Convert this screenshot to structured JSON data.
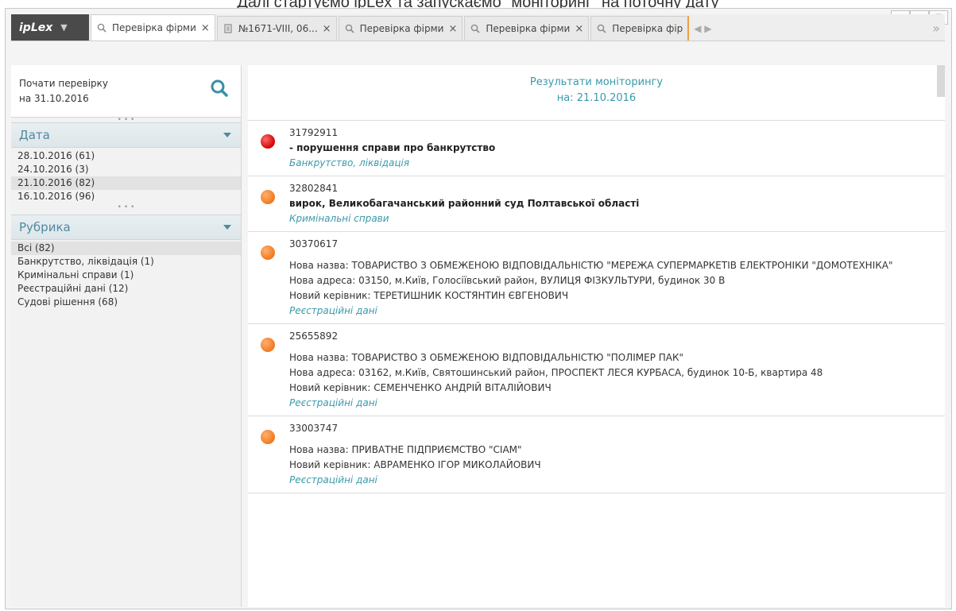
{
  "caption": "Далі стартуємо ipLex та запускаємо \"моніторинг\" на поточну дату",
  "window_controls": {
    "minimize": "▭",
    "restore": "▣",
    "close": "☒"
  },
  "brand": {
    "name": "ipLex",
    "caret": "▼"
  },
  "tabs": [
    {
      "label": "Перевірка фірми",
      "icon": "search-icon",
      "active": true
    },
    {
      "label": "№1671-VIII, 06...",
      "icon": "document-icon",
      "active": false
    },
    {
      "label": "Перевірка фірми",
      "icon": "search-icon",
      "active": false
    },
    {
      "label": "Перевірка фірми",
      "icon": "search-icon",
      "active": false
    },
    {
      "label": "Перевірка фір",
      "icon": "search-icon",
      "active": false
    }
  ],
  "tab_close": "×",
  "tab_scroll": "◀ ▶",
  "tab_more": "»",
  "sidebar": {
    "start_line1": "Почати перевірку",
    "start_line2": "на 31.10.2016",
    "date_section": {
      "title": "Дата",
      "items": [
        "28.10.2016 (61)",
        "24.10.2016 (3)",
        "21.10.2016 (82)",
        "16.10.2016 (96)"
      ],
      "selected_index": 2
    },
    "rubric_section": {
      "title": "Рубрика",
      "items": [
        "Всі (82)",
        "Банкрутство, ліквідація (1)",
        "Кримінальні справи (1)",
        "Реєстраційні дані (12)",
        "Судові рішення (68)"
      ],
      "selected_index": 0
    }
  },
  "results": {
    "title": "Результати моніторингу",
    "date": "на: 21.10.2016",
    "items": [
      {
        "code": "31792911",
        "color": "red",
        "title": "- порушення справи про банкрутство",
        "category": "Банкрутство, ліквідація"
      },
      {
        "code": "32802841",
        "color": "orange",
        "title": "вирок, Великобагачанський районний суд Полтавської області",
        "category": "Кримінальні справи"
      },
      {
        "code": "30370617",
        "color": "orange",
        "new_name": "Нова назва: ТОВАРИСТВО З ОБМЕЖЕНОЮ ВІДПОВІДАЛЬНІСТЮ \"МЕРЕЖА СУПЕРМАРКЕТІВ ЕЛЕКТРОНІКИ \"ДОМОТЕХНІКА\"",
        "new_address": "Нова адреса: 03150, м.Київ, Голосіївський район, ВУЛИЦЯ ФІЗКУЛЬТУРИ, будинок 30 В",
        "new_head": "Новий керівник: ТЕРЕТИШНИК КОСТЯНТИН ЄВГЕНОВИЧ",
        "category": "Реєстраційні дані"
      },
      {
        "code": "25655892",
        "color": "orange",
        "new_name": "Нова назва: ТОВАРИСТВО З ОБМЕЖЕНОЮ ВІДПОВІДАЛЬНІСТЮ \"ПОЛІМЕР ПАК\"",
        "new_address": "Нова адреса: 03162, м.Київ, Святошинський район, ПРОСПЕКТ ЛЕСЯ КУРБАСА, будинок 10-Б, квартира 48",
        "new_head": "Новий керівник: СЕМЕНЧЕНКО АНДРІЙ ВІТАЛІЙОВИЧ",
        "category": "Реєстраційні дані"
      },
      {
        "code": "33003747",
        "color": "orange",
        "new_name": "Нова назва: ПРИВАТНЕ ПІДПРИЄМСТВО \"СІАМ\"",
        "new_head": "Новий керівник: АВРАМЕНКО ІГОР МИКОЛАЙОВИЧ",
        "category": "Реєстраційні дані"
      }
    ]
  }
}
